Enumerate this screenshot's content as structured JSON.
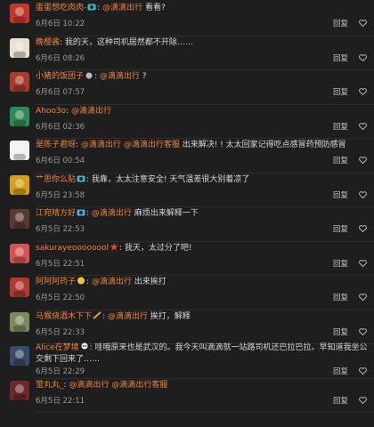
{
  "actions": {
    "reply": "回复",
    "like_icon": "heart-icon"
  },
  "comments": [
    {
      "user": "蛋蛋想吃肉肉-",
      "badge": "camera-icon",
      "mention": "@滴滴出行",
      "mention2": "",
      "text": " 看看?",
      "time": "6月6日 10:22",
      "avatar": "#c0392b"
    },
    {
      "user": "晚樱酱",
      "badge": "",
      "mention": "",
      "mention2": "",
      "text": ": 我的天，这种司机居然都不开除……",
      "time": "6月6日 08:26",
      "avatar": "#e8e0d0"
    },
    {
      "user": "小猪的饭团子",
      "badge": "cloud-icon",
      "mention": "@滴滴出行",
      "mention2": "",
      "text": " ?",
      "time": "6月6日 07:57",
      "avatar": "#a93a2c"
    },
    {
      "user": "Ahoo3o",
      "badge": "",
      "mention": "@滴滴出行",
      "mention2": "",
      "text": "",
      "time": "6月6日 02:36",
      "avatar": "#2e8b57"
    },
    {
      "user": "是陈子君呀",
      "badge": "",
      "mention": "@滴滴出行",
      "mention2": "@滴滴出行客服",
      "text": " 出来解决! ! 太太回家记得吃点感冒药预防感冒",
      "time": "6月6日 00:54",
      "avatar": "#f2f2f2"
    },
    {
      "user": "艹思你么贴",
      "badge": "camera-icon",
      "mention": "",
      "mention2": "",
      "text": ": 我靠，太太注意安全! 天气温差很大别着凉了",
      "time": "6月5日 23:58",
      "avatar": "#d4a017"
    },
    {
      "user": "江宛晴方好",
      "badge": "camera-icon",
      "mention": "@滴滴出行",
      "mention2": "",
      "text": " 麻烦出来解释一下",
      "time": "6月5日 22:53",
      "avatar": "#5d3a2e"
    },
    {
      "user": "sakurayeoooooool",
      "badge": "star-icon",
      "mention": "",
      "mention2": "",
      "text": ": 我天，太过分了吧!",
      "time": "6月5日 22:51",
      "avatar": "#d35454"
    },
    {
      "user": "阿阿阿药子",
      "badge": "smile-icon",
      "mention": "@滴滴出行",
      "mention2": "",
      "text": " 出来挨打",
      "time": "6月5日 22:50",
      "avatar": "#b03a2e"
    },
    {
      "user": "马猴烧酒木下下",
      "badge": "firework-icon",
      "mention": "@滴滴出行",
      "mention2": "",
      "text": " 挨打，解释",
      "time": "6月5日 22:33",
      "avatar": "#7a8a5c"
    },
    {
      "user": "Alice在梦境",
      "badge": "skull-icon",
      "mention": "",
      "mention2": "",
      "text": ": 哇哦原来也是武汉的。我今天叫滴滴就一站路司机还巴拉巴拉。早知道我坐公交剩下回来了……",
      "time": "6月5日 22:29",
      "avatar": "#3a4a6a"
    },
    {
      "user": "萤丸丸_",
      "badge": "",
      "mention": "@滴滴出行",
      "mention2": "@滴滴出行客服",
      "text": "",
      "time": "6月5日 22:11",
      "avatar": "#6a2a2a"
    }
  ]
}
